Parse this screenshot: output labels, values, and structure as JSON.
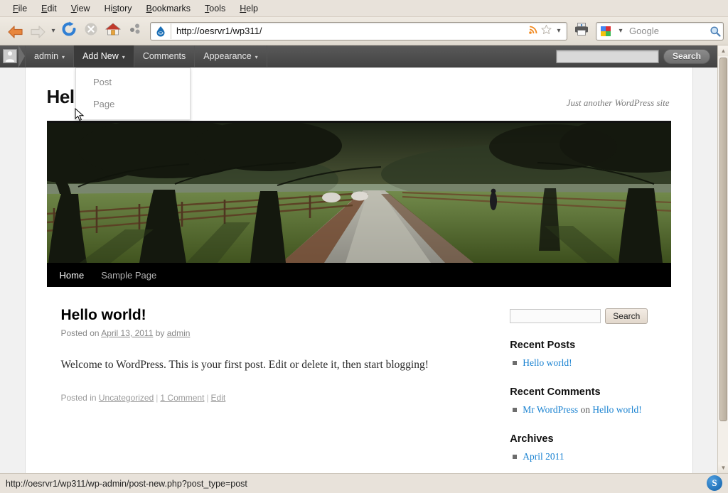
{
  "browser": {
    "menus": [
      "File",
      "Edit",
      "View",
      "History",
      "Bookmarks",
      "Tools",
      "Help"
    ],
    "nav": {
      "back_icon": "back-arrow-icon",
      "forward_icon": "forward-arrow-icon",
      "dropdown_icon": "chevron-down-icon",
      "reload_icon": "reload-icon",
      "stop_icon": "stop-icon",
      "home_icon": "home-icon",
      "feed_share_icon": "share-icon"
    },
    "url": "http://oesrvr1/wp311/",
    "url_favicon": "droplet-favicon",
    "url_icons": [
      "rss-feed-icon",
      "bookmark-star-icon",
      "chevron-down-icon"
    ],
    "print_icon": "printer-icon",
    "search": {
      "engine_icon": "google-logo-icon",
      "engine_caret": "chevron-down-icon",
      "placeholder": "Google",
      "value": "",
      "go_icon": "magnifier-icon"
    }
  },
  "adminbar": {
    "avatar_icon": "user-avatar-icon",
    "items": [
      {
        "label": "admin",
        "caret": "▾",
        "active": false
      },
      {
        "label": "Add New",
        "caret": "▾",
        "active": true
      },
      {
        "label": "Comments",
        "caret": "",
        "active": false
      },
      {
        "label": "Appearance",
        "caret": "▾",
        "active": false
      }
    ],
    "search_value": "",
    "search_button": "Search",
    "dropdown": {
      "open_for": "Add New",
      "items": [
        "Post",
        "Page"
      ]
    }
  },
  "site": {
    "title": "Hello World",
    "description": "Just another WordPress site",
    "header_image_alt": "tree-lined lane with person walking",
    "nav": [
      {
        "label": "Home",
        "current": true
      },
      {
        "label": "Sample Page",
        "current": false
      }
    ]
  },
  "post": {
    "title": "Hello world!",
    "meta_prefix": "Posted on ",
    "date": "April 13, 2011",
    "meta_by": " by ",
    "author": "admin",
    "body": "Welcome to WordPress. This is your first post. Edit or delete it, then start blogging!",
    "footer_prefix": "Posted in ",
    "category": "Uncategorized",
    "comments": "1 Comment",
    "edit": "Edit"
  },
  "sidebar": {
    "search_value": "",
    "search_button": "Search",
    "recent_posts": {
      "title": "Recent Posts",
      "items": [
        {
          "text": "Hello world!"
        }
      ]
    },
    "recent_comments": {
      "title": "Recent Comments",
      "items": [
        {
          "author": "Mr WordPress",
          "on": " on ",
          "post": "Hello world!"
        }
      ]
    },
    "archives": {
      "title": "Archives",
      "items": [
        {
          "text": "April 2011"
        }
      ]
    }
  },
  "statusbar": {
    "url": "http://oesrvr1/wp311/wp-admin/post-new.php?post_type=post",
    "tray_icon_label": "S"
  },
  "scrollbar": {
    "up_icon": "chevron-up-icon",
    "down_icon": "chevron-down-icon"
  },
  "colors": {
    "adminbar_bg": "#464646",
    "link_blue": "#1982d1",
    "chrome_bg": "#e8e2da"
  }
}
